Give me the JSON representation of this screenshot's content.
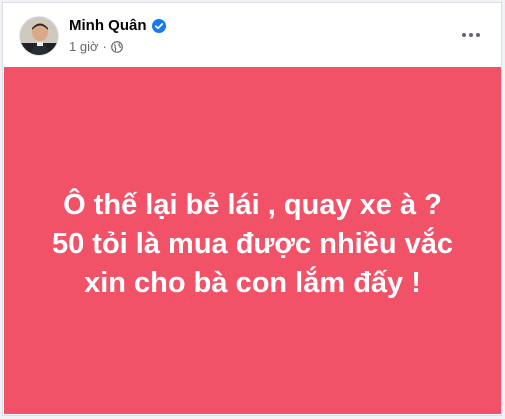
{
  "post": {
    "author": {
      "name": "Minh Quân",
      "verified": true
    },
    "time": "1 giờ",
    "meta_separator": "·",
    "privacy_icon": "globe-icon",
    "more_icon": "more-horizontal-icon",
    "background_color": "#f25268",
    "text_color": "#ffffff",
    "text_lines": [
      "Ô thế lại bẻ lái , quay xe à ?",
      "50 tỏi là mua được nhiều vắc",
      "xin cho bà con lắm đấy !"
    ]
  },
  "colors": {
    "verified_badge": "#1877f2",
    "name_text": "#050505",
    "meta_text": "#65676b"
  }
}
